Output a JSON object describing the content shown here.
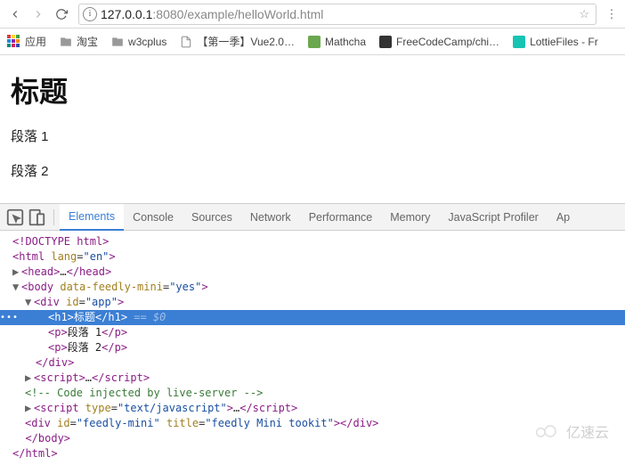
{
  "url": {
    "host": "127.0.0.1",
    "port": ":8080",
    "path": "/example/helloWorld.html"
  },
  "bookmarks": {
    "apps": "应用",
    "taobao": "淘宝",
    "w3cplus": "w3cplus",
    "vue": "【第一季】Vue2.0…",
    "mathcha": "Mathcha",
    "fcc": "FreeCodeCamp/chi…",
    "lottie": "LottieFiles - Fr"
  },
  "page": {
    "title": "标题",
    "p1": "段落 1",
    "p2": "段落 2"
  },
  "devtools": {
    "tabs": {
      "elements": "Elements",
      "console": "Console",
      "sources": "Sources",
      "network": "Network",
      "performance": "Performance",
      "memory": "Memory",
      "jsprofiler": "JavaScript Profiler",
      "app": "Ap"
    },
    "dom": {
      "doctype": "<!DOCTYPE html>",
      "html_open": "<html lang=\"en\">",
      "head": "<head>…</head>",
      "body_open": "<body data-feedly-mini=\"yes\">",
      "div_open": "<div id=\"app\">",
      "h1": "<h1>标题</h1>",
      "helper": " == $0",
      "p1": "<p>段落 1</p>",
      "p2": "<p>段落 2</p>",
      "div_close": "</div>",
      "script1": "<script>…</script>",
      "comment": "<!-- Code injected by live-server -->",
      "script2": "<script type=\"text/javascript\">…</script>",
      "feedly": "<div id=\"feedly-mini\" title=\"feedly Mini tookit\"></div>",
      "body_close": "</body>",
      "html_close": "</html>"
    }
  },
  "watermark": "亿速云"
}
